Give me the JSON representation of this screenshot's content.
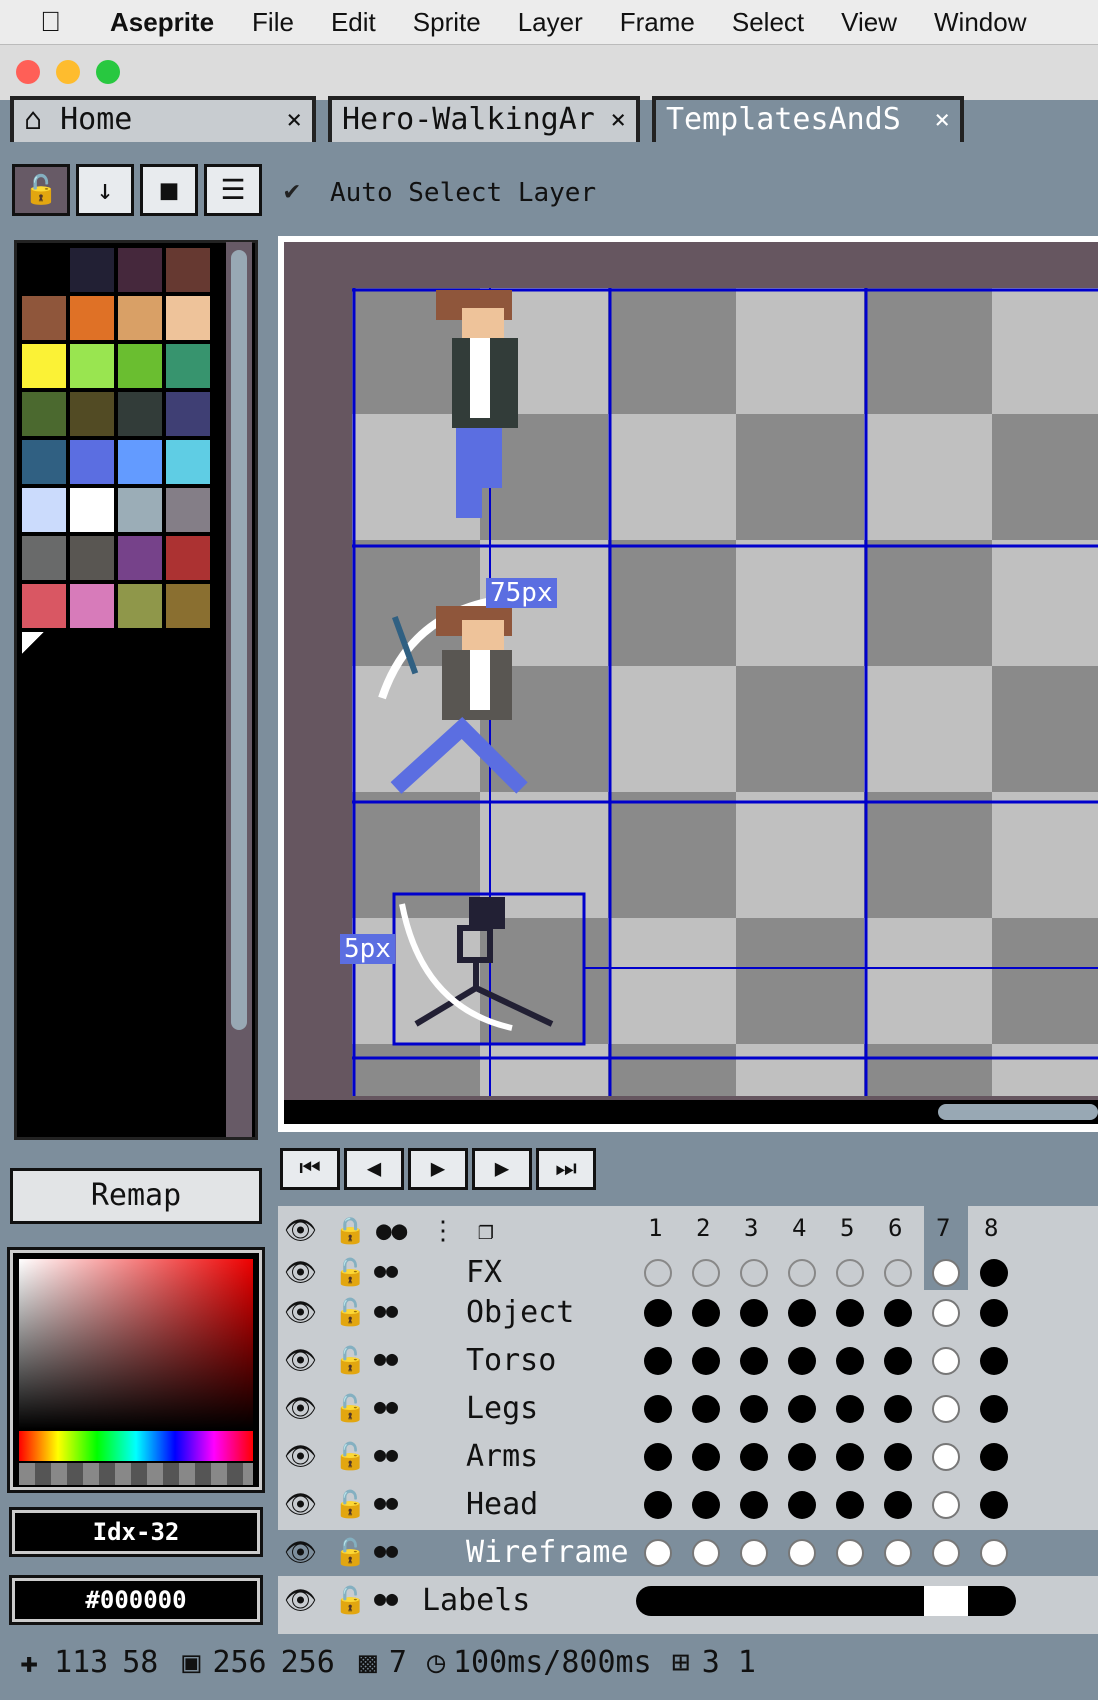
{
  "menubar": {
    "app": "Aseprite",
    "items": [
      "File",
      "Edit",
      "Sprite",
      "Layer",
      "Frame",
      "Select",
      "View",
      "Window"
    ]
  },
  "tabs": [
    {
      "label": "Home",
      "icon": "home-icon"
    },
    {
      "label": "Hero-WalkingAr",
      "icon": ""
    },
    {
      "label": "TemplatesAndS",
      "icon": ""
    }
  ],
  "toolbar": {
    "auto_select_label": "Auto Select Layer",
    "auto_select_checked": true
  },
  "palette": {
    "colors": [
      "#000000",
      "#222034",
      "#45283c",
      "#663931",
      "#8f563b",
      "#df7126",
      "#d9a066",
      "#eec39a",
      "#fbf236",
      "#99e550",
      "#6abe30",
      "#37946e",
      "#4b692f",
      "#524b24",
      "#323c39",
      "#3f3f74",
      "#306082",
      "#5b6ee1",
      "#639bff",
      "#5fcde4",
      "#cbdbfc",
      "#ffffff",
      "#9badb7",
      "#847e87",
      "#696a6a",
      "#595652",
      "#76428a",
      "#ac3232",
      "#d95763",
      "#d77bba",
      "#8f974a",
      "#8a6f30"
    ]
  },
  "remap_label": "Remap",
  "color_index": "Idx-32",
  "color_hex": "#000000",
  "canvas": {
    "label_top": "75px",
    "label_left": "5px"
  },
  "timeline": {
    "frames": [
      "1",
      "2",
      "3",
      "4",
      "5",
      "6",
      "7",
      "8"
    ],
    "current_frame": 7,
    "layers": [
      {
        "name": "FX",
        "cels": [
          "empty",
          "empty",
          "empty",
          "empty",
          "empty",
          "empty",
          "current",
          "filled"
        ]
      },
      {
        "name": "Object",
        "cels": [
          "filled",
          "filled",
          "filled",
          "filled",
          "filled",
          "filled",
          "current",
          "filled"
        ]
      },
      {
        "name": "Torso",
        "cels": [
          "filled",
          "filled",
          "filled",
          "filled",
          "filled",
          "filled",
          "current",
          "filled"
        ]
      },
      {
        "name": "Legs",
        "cels": [
          "filled",
          "filled",
          "filled",
          "filled",
          "filled",
          "filled",
          "current",
          "filled"
        ]
      },
      {
        "name": "Arms",
        "cels": [
          "filled",
          "filled",
          "filled",
          "filled",
          "filled",
          "filled",
          "current",
          "filled"
        ]
      },
      {
        "name": "Head",
        "cels": [
          "filled",
          "filled",
          "filled",
          "filled",
          "filled",
          "filled",
          "current",
          "filled"
        ]
      },
      {
        "name": "Wireframe",
        "cels": [
          "white",
          "white",
          "white",
          "white",
          "white",
          "white",
          "current",
          "white"
        ],
        "selected": true
      },
      {
        "name": "Labels",
        "cels": [
          "bar"
        ]
      }
    ]
  },
  "status": {
    "pos_x": "113",
    "pos_y": "58",
    "size_w": "256",
    "size_h": "256",
    "frame": "7",
    "duration": "100ms/800ms",
    "grid": "3 1"
  }
}
